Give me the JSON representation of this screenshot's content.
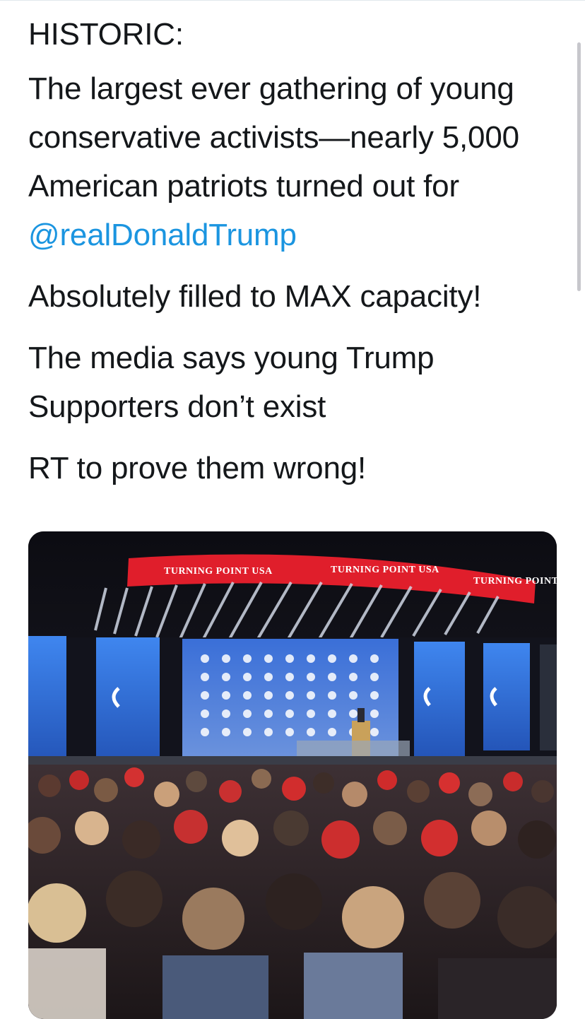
{
  "tweet": {
    "heading": "HISTORIC:",
    "body_line_1": "The largest ever gathering of young conservative activists—nearly 5,000 American patriots turned out for ",
    "mention": "@realDonaldTrump",
    "paragraph_2": "Absolutely filled to MAX capacity!",
    "paragraph_3": "The media says young Trump Supporters don’t exist",
    "paragraph_4": "RT to prove them wrong!"
  },
  "media": {
    "banner_text_1": "TURNING POINT USA",
    "banner_text_2": "TURNING POINT USA",
    "banner_text_3": "TURNING POINT USA"
  },
  "colors": {
    "mention": "#1b95e0",
    "banner_red": "#e01e2b",
    "screen_blue": "#2f6fd6",
    "text": "#14171a"
  }
}
